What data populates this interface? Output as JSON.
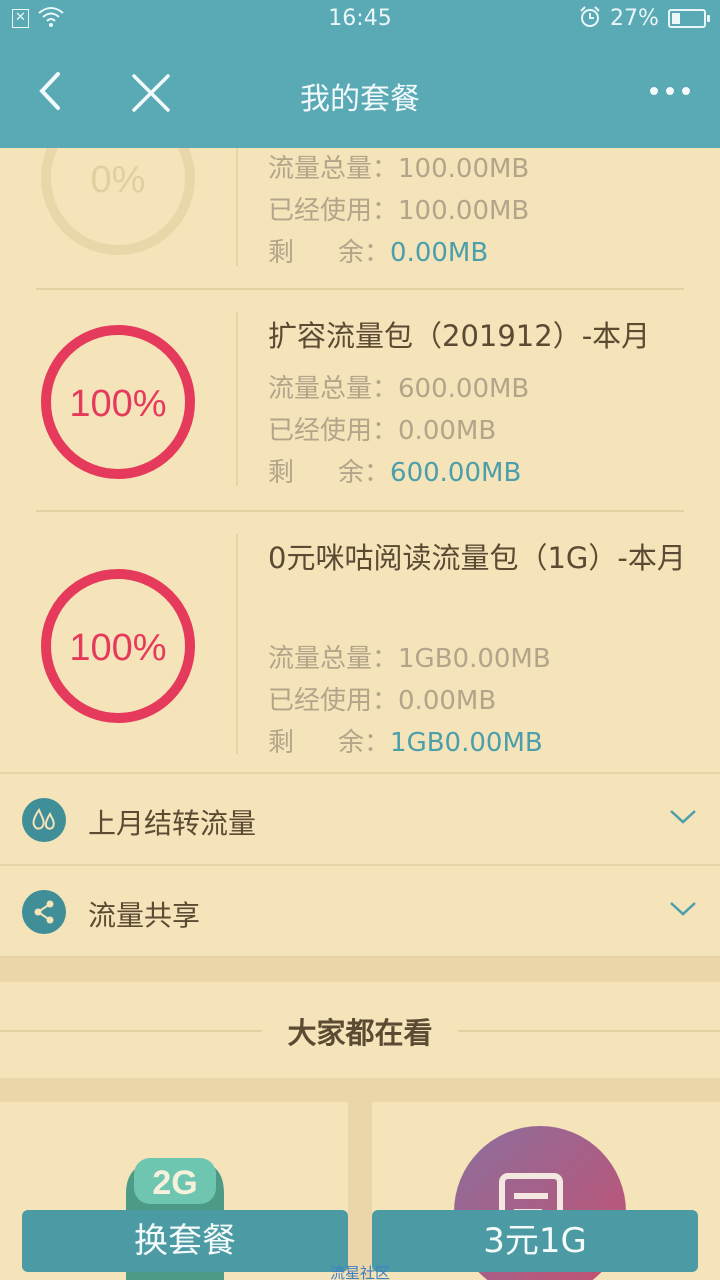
{
  "status_bar": {
    "time": "16:45",
    "battery": "27%",
    "battery_level": 0.27
  },
  "nav": {
    "title": "我的套餐",
    "back_icon": "chevron-left-icon",
    "close_icon": "close-icon",
    "more_icon": "more-dots-icon"
  },
  "packages": [
    {
      "percent": "0%",
      "percent_value": 0,
      "total_label": "流量总量：",
      "total": "100.00MB",
      "used_label": "已经使用：",
      "used": "100.00MB",
      "remain_label_a": "剩",
      "remain_label_b": "余：",
      "remain": "0.00MB"
    },
    {
      "name": "扩容流量包（201912）-本月",
      "percent": "100%",
      "percent_value": 100,
      "total_label": "流量总量：",
      "total": "600.00MB",
      "used_label": "已经使用：",
      "used": "0.00MB",
      "remain_label_a": "剩",
      "remain_label_b": "余：",
      "remain": "600.00MB"
    },
    {
      "name": "0元咪咕阅读流量包（1G）-本月",
      "percent": "100%",
      "percent_value": 100,
      "total_label": "流量总量：",
      "total": "1GB0.00MB",
      "used_label": "已经使用：",
      "used": "0.00MB",
      "remain_label_a": "剩",
      "remain_label_b": "余：",
      "remain": "1GB0.00MB"
    }
  ],
  "sections": [
    {
      "label": "上月结转流量",
      "icon": "water-drops-icon"
    },
    {
      "label": "流量共享",
      "icon": "share-icon"
    }
  ],
  "popular": {
    "title": "大家都在看",
    "card_left_badge": "2G"
  },
  "buttons": {
    "change_plan": "换套餐",
    "buy_data": "3元1G"
  },
  "watermark": "流星社区",
  "colors": {
    "header": "#5aaab6",
    "background": "#f5e3ba",
    "ring_full": "#e63a5c",
    "ring_empty": "#e9d7aa",
    "accent_value": "#4a9fab",
    "button": "#4c9aa3"
  }
}
